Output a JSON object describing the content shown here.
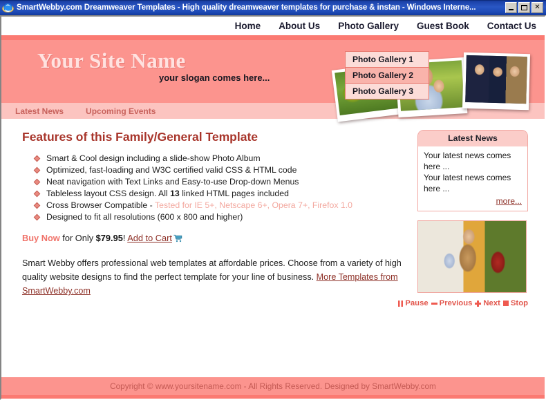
{
  "window": {
    "title": "SmartWebby.com Dreamweaver Templates - High quality dreamweaver templates for purchase & instan - Windows Interne...",
    "app_icon": "internet-explorer-icon",
    "minimize_label": "_",
    "maximize_label": "□",
    "close_label": "✕"
  },
  "topnav": {
    "items": [
      {
        "label": "Home"
      },
      {
        "label": "About Us"
      },
      {
        "label": "Photo Gallery"
      },
      {
        "label": "Guest Book"
      },
      {
        "label": "Contact Us"
      }
    ]
  },
  "dropdown": {
    "open_for": "Photo Gallery",
    "items": [
      {
        "label": "Photo Gallery 1",
        "hovered": false
      },
      {
        "label": "Photo Gallery 2",
        "hovered": true
      },
      {
        "label": "Photo Gallery 3",
        "hovered": false
      }
    ]
  },
  "banner": {
    "site_name": "Your Site Name",
    "slogan": "your slogan comes here...",
    "photos": [
      {
        "alt": "family picnic on grass"
      },
      {
        "alt": "mother holding child outdoors"
      },
      {
        "alt": "graduate with grandparents"
      }
    ]
  },
  "subnav": {
    "items": [
      {
        "label": "Latest News"
      },
      {
        "label": "Upcoming Events"
      }
    ]
  },
  "main": {
    "features_title": "Features of this Family/General Template",
    "features": [
      {
        "text": "Smart & Cool design including a slide-show Photo Album"
      },
      {
        "text": "Optimized, fast-loading and W3C certified valid CSS & HTML code"
      },
      {
        "text": "Neat navigation with Text Links and Easy-to-use Drop-down Menus"
      },
      {
        "pre": "Tableless layout CSS design. All ",
        "bold": "13",
        "post": " linked HTML pages included"
      },
      {
        "pre": "Cross Browser Compatible - ",
        "muted": "Tested for IE 5+, Netscape 6+, Opera 7+, Firefox 1.0"
      },
      {
        "text": "Designed to fit all resolutions (600 x 800 and higher)"
      }
    ],
    "buy": {
      "buy_now": "Buy Now",
      "for_only": " for Only ",
      "price": "$79.95",
      "exclaim": "! ",
      "cart_link": "Add to Cart",
      "cart_icon": "shopping-cart-icon"
    },
    "blurb": {
      "part1": "Smart Webby offers professional web templates at affordable prices. Choose from a variety of high quality website designs to find the perfect template for your line of business. ",
      "link": "More Templates from SmartWebby.com"
    }
  },
  "sidebar": {
    "news": {
      "title": "Latest News",
      "line1": "Your latest news comes here ...",
      "line2": "Your latest news comes here ...",
      "more_label": "more..."
    },
    "photo": {
      "alt": "mother and child with shopping bag in autumn"
    },
    "slideshow": {
      "pause": "Pause",
      "previous": "Previous",
      "next": "Next",
      "stop": "Stop"
    }
  },
  "footer": {
    "text": "Copyright © www.yoursitename.com - All Rights Reserved. Designed by SmartWebby.com"
  },
  "colors": {
    "banner_pink": "#fc948e",
    "banner_stripe": "#fb7a72",
    "subnav_pink": "#fcc4c0",
    "heading_red": "#a8352b",
    "link_red": "#8d2f26",
    "accent_red": "#ef5a50",
    "titlebar_blue": "#1b41a8"
  }
}
